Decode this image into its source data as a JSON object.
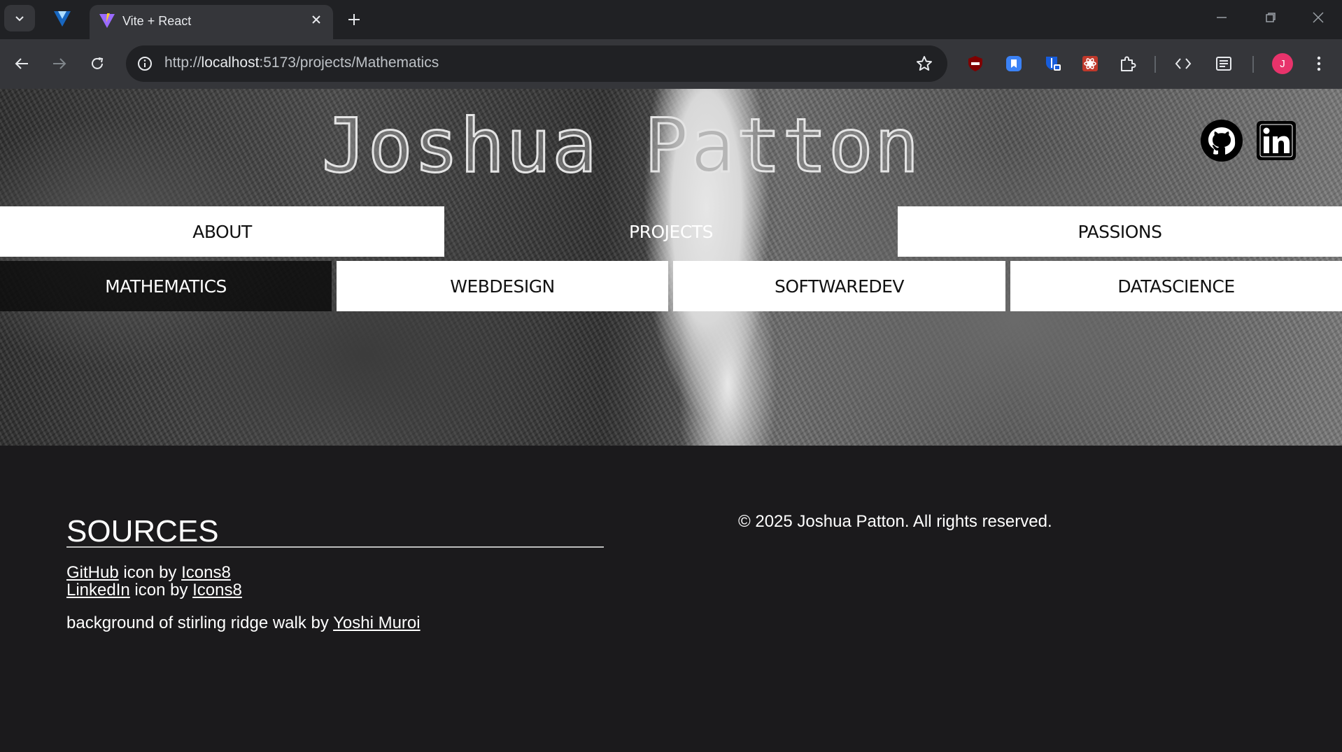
{
  "browser": {
    "tab_title": "Vite + React",
    "url_prefix": "http://",
    "url_host": "localhost",
    "url_rest": ":5173/projects/Mathematics",
    "avatar_initial": "J"
  },
  "hero": {
    "title": "Joshua Patton",
    "social": [
      "github-icon",
      "linkedin-icon"
    ]
  },
  "nav": {
    "primary": [
      {
        "label": "ABOUT",
        "active": false
      },
      {
        "label": "PROJECTS",
        "active": true
      },
      {
        "label": "PASSIONS",
        "active": false
      }
    ],
    "secondary": [
      {
        "label": "MATHEMATICS",
        "active": true
      },
      {
        "label": "WEBDESIGN",
        "active": false
      },
      {
        "label": "SOFTWAREDEV",
        "active": false
      },
      {
        "label": "DATASCIENCE",
        "active": false
      }
    ]
  },
  "footer": {
    "sources_title": "SOURCES",
    "credits": [
      {
        "link": "GitHub",
        "mid": " icon by ",
        "author": "Icons8"
      },
      {
        "link": "LinkedIn",
        "mid": " icon by ",
        "author": "Icons8"
      }
    ],
    "background_text": "background of stirling ridge walk by ",
    "background_author": "Yoshi Muroi",
    "copyright": "© 2025 Joshua Patton. All rights reserved."
  },
  "colors": {
    "browser_dark": "#202124",
    "browser_toolbar": "#35363a",
    "page_bg": "#1b1a1c",
    "avatar": "#e8336b"
  }
}
